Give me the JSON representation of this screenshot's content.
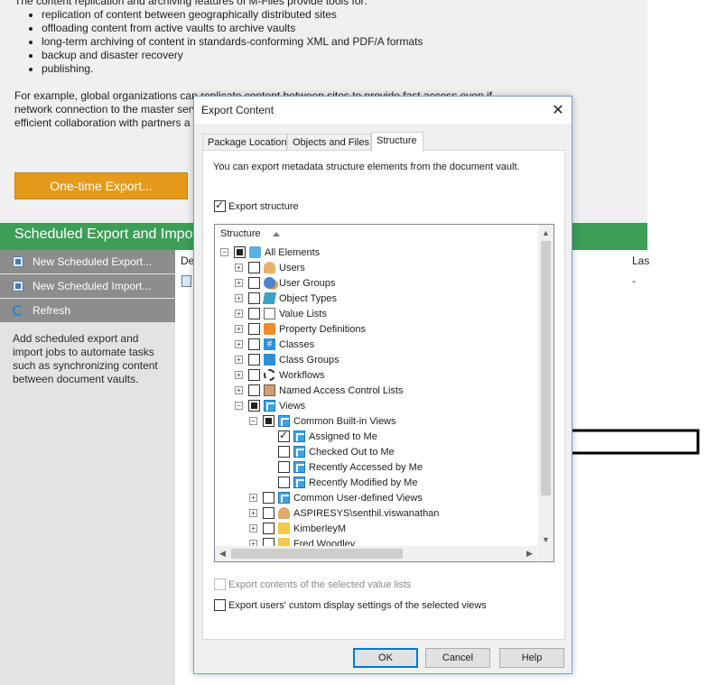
{
  "background": {
    "intro": "The content replication and archiving features of M-Files provide tools for:",
    "bullets": [
      "replication of content between geographically distributed sites",
      "offloading content from active vaults to archive vaults",
      "long-term archiving of content in standards-conforming XML and PDF/A formats",
      "backup and disaster recovery",
      "publishing."
    ],
    "example_lines": [
      "For example, global organizations can replicate content between sites to provide fast access even if",
      "network connection to the master server",
      "efficient collaboration with partners a"
    ],
    "one_time_export_label": "One-time Export...",
    "section_header": "Scheduled Export and Import",
    "side_actions": [
      "New Scheduled Export...",
      "New Scheduled Import...",
      "Refresh"
    ],
    "side_help": "Add scheduled export and import jobs to automate tasks such as synchronizing content between document vaults.",
    "list_col_1": "De",
    "list_col_2": "Las",
    "list_row_value": "-"
  },
  "dialog": {
    "title": "Export Content",
    "tabs": [
      "Package Location",
      "Objects and Files",
      "Structure"
    ],
    "active_tab": "Structure",
    "description": "You can export metadata structure elements from the document vault.",
    "export_structure_label": "Export structure",
    "export_structure_checked": true,
    "tree_column": "Structure",
    "tree": [
      {
        "label": "All Elements",
        "level": 0,
        "expander": "−",
        "check": "partial",
        "icon": "all-elements-icon"
      },
      {
        "label": "Users",
        "level": 1,
        "expander": "+",
        "check": "unchecked",
        "icon": "users-icon"
      },
      {
        "label": "User Groups",
        "level": 1,
        "expander": "+",
        "check": "unchecked",
        "icon": "user-groups-icon"
      },
      {
        "label": "Object Types",
        "level": 1,
        "expander": "+",
        "check": "unchecked",
        "icon": "object-types-icon"
      },
      {
        "label": "Value Lists",
        "level": 1,
        "expander": "+",
        "check": "unchecked",
        "icon": "value-lists-icon"
      },
      {
        "label": "Property Definitions",
        "level": 1,
        "expander": "+",
        "check": "unchecked",
        "icon": "property-definitions-icon"
      },
      {
        "label": "Classes",
        "level": 1,
        "expander": "+",
        "check": "unchecked",
        "icon": "classes-icon"
      },
      {
        "label": "Class Groups",
        "level": 1,
        "expander": "+",
        "check": "unchecked",
        "icon": "class-groups-icon"
      },
      {
        "label": "Workflows",
        "level": 1,
        "expander": "+",
        "check": "unchecked",
        "icon": "workflows-icon"
      },
      {
        "label": "Named Access Control Lists",
        "level": 1,
        "expander": "+",
        "check": "unchecked",
        "icon": "named-acl-icon"
      },
      {
        "label": "Views",
        "level": 1,
        "expander": "−",
        "check": "partial",
        "icon": "views-icon"
      },
      {
        "label": "Common Built-in Views",
        "level": 2,
        "expander": "−",
        "check": "partial",
        "icon": "view-icon"
      },
      {
        "label": "Assigned to Me",
        "level": 3,
        "expander": "",
        "check": "checked",
        "icon": "view-icon"
      },
      {
        "label": "Checked Out to Me",
        "level": 3,
        "expander": "",
        "check": "unchecked",
        "icon": "view-icon"
      },
      {
        "label": "Recently Accessed by Me",
        "level": 3,
        "expander": "",
        "check": "unchecked",
        "icon": "view-icon"
      },
      {
        "label": "Recently Modified by Me",
        "level": 3,
        "expander": "",
        "check": "unchecked",
        "icon": "view-icon"
      },
      {
        "label": "Common User-defined Views",
        "level": 2,
        "expander": "+",
        "check": "unchecked",
        "icon": "view-icon"
      },
      {
        "label": "ASPIRESYS\\senthil.viswanathan",
        "level": 2,
        "expander": "+",
        "check": "unchecked",
        "icon": "user-icon"
      },
      {
        "label": "KimberleyM",
        "level": 2,
        "expander": "+",
        "check": "unchecked",
        "icon": "folder-icon"
      },
      {
        "label": "Fred Woodley",
        "level": 2,
        "expander": "+",
        "check": "unchecked",
        "icon": "folder-icon"
      }
    ],
    "export_value_lists_label": "Export contents of the selected value lists",
    "export_value_lists_enabled": false,
    "export_custom_display_label": "Export users' custom display settings of the selected views",
    "buttons": {
      "ok": "OK",
      "cancel": "Cancel",
      "help": "Help"
    }
  },
  "colors": {
    "accent_orange": "#e69a19",
    "section_green": "#3d9e58",
    "dialog_focus": "#0078d7"
  }
}
